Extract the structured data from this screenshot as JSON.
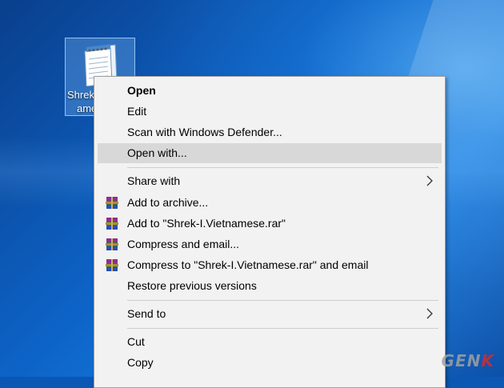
{
  "desktop": {
    "icon_label_line1": "Shrek",
    "icon_label_line2": "ame",
    "icon_name": "notepad-file-icon"
  },
  "context_menu": {
    "items": [
      {
        "label": "Open",
        "bold": true
      },
      {
        "label": "Edit"
      },
      {
        "label": "Scan with Windows Defender..."
      },
      {
        "label": "Open with...",
        "highlighted": true
      },
      {
        "label": "Share with",
        "submenu": true
      },
      {
        "label": "Add to archive...",
        "icon": "winrar-icon"
      },
      {
        "label": "Add to \"Shrek-I.Vietnamese.rar\"",
        "icon": "winrar-icon"
      },
      {
        "label": "Compress and email...",
        "icon": "winrar-icon"
      },
      {
        "label": "Compress to \"Shrek-I.Vietnamese.rar\" and email",
        "icon": "winrar-icon"
      },
      {
        "label": "Restore previous versions"
      },
      {
        "label": "Send to",
        "submenu": true
      },
      {
        "label": "Cut"
      },
      {
        "label": "Copy"
      }
    ]
  },
  "watermark": {
    "text_main": "GEN",
    "text_accent": "K"
  }
}
